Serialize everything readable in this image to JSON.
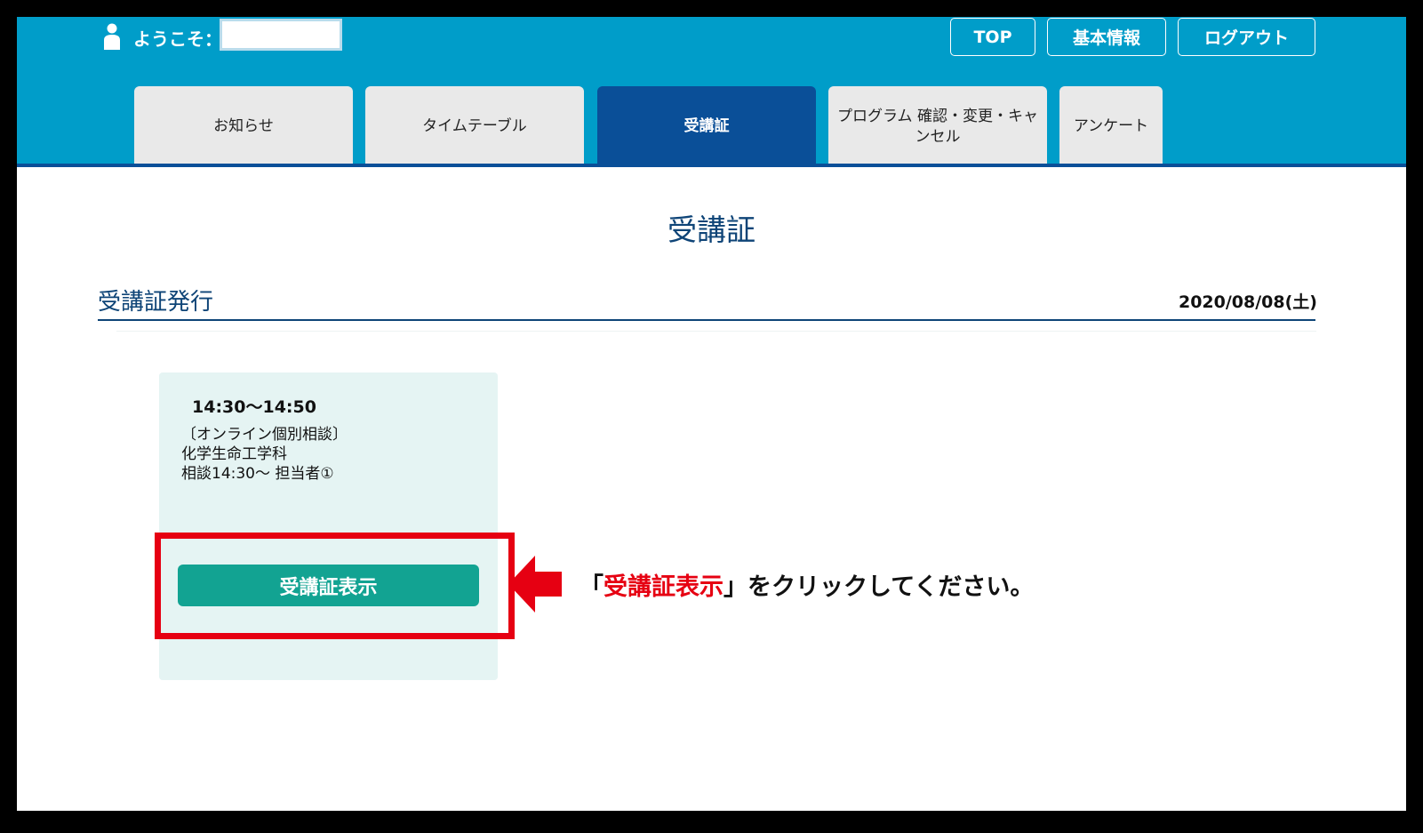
{
  "header": {
    "welcome": "ようこそ：",
    "buttons": {
      "top": "TOP",
      "profile": "基本情報",
      "logout": "ログアウト"
    }
  },
  "tabs": [
    {
      "label": "お知らせ",
      "active": false
    },
    {
      "label": "タイムテーブル",
      "active": false
    },
    {
      "label": "受講証",
      "active": true
    },
    {
      "label": "プログラム 確認・変更・キャンセル",
      "active": false
    },
    {
      "label": "アンケート",
      "active": false
    }
  ],
  "page": {
    "title": "受講証"
  },
  "section": {
    "title": "受講証発行",
    "date": "2020/08/08(土)"
  },
  "card": {
    "time": "14:30～14:50",
    "lines": [
      "〔オンライン個別相談〕",
      "化学生命工学科",
      "相談14:30～ 担当者①"
    ],
    "button_label": "受講証表示"
  },
  "instruction": {
    "open": "「",
    "emphasis": "受講証表示",
    "rest": "」をクリックしてください。"
  },
  "colors": {
    "header_bg": "#009dc9",
    "active_tab": "#0a4f98",
    "button": "#12a392",
    "highlight": "#e60012"
  }
}
